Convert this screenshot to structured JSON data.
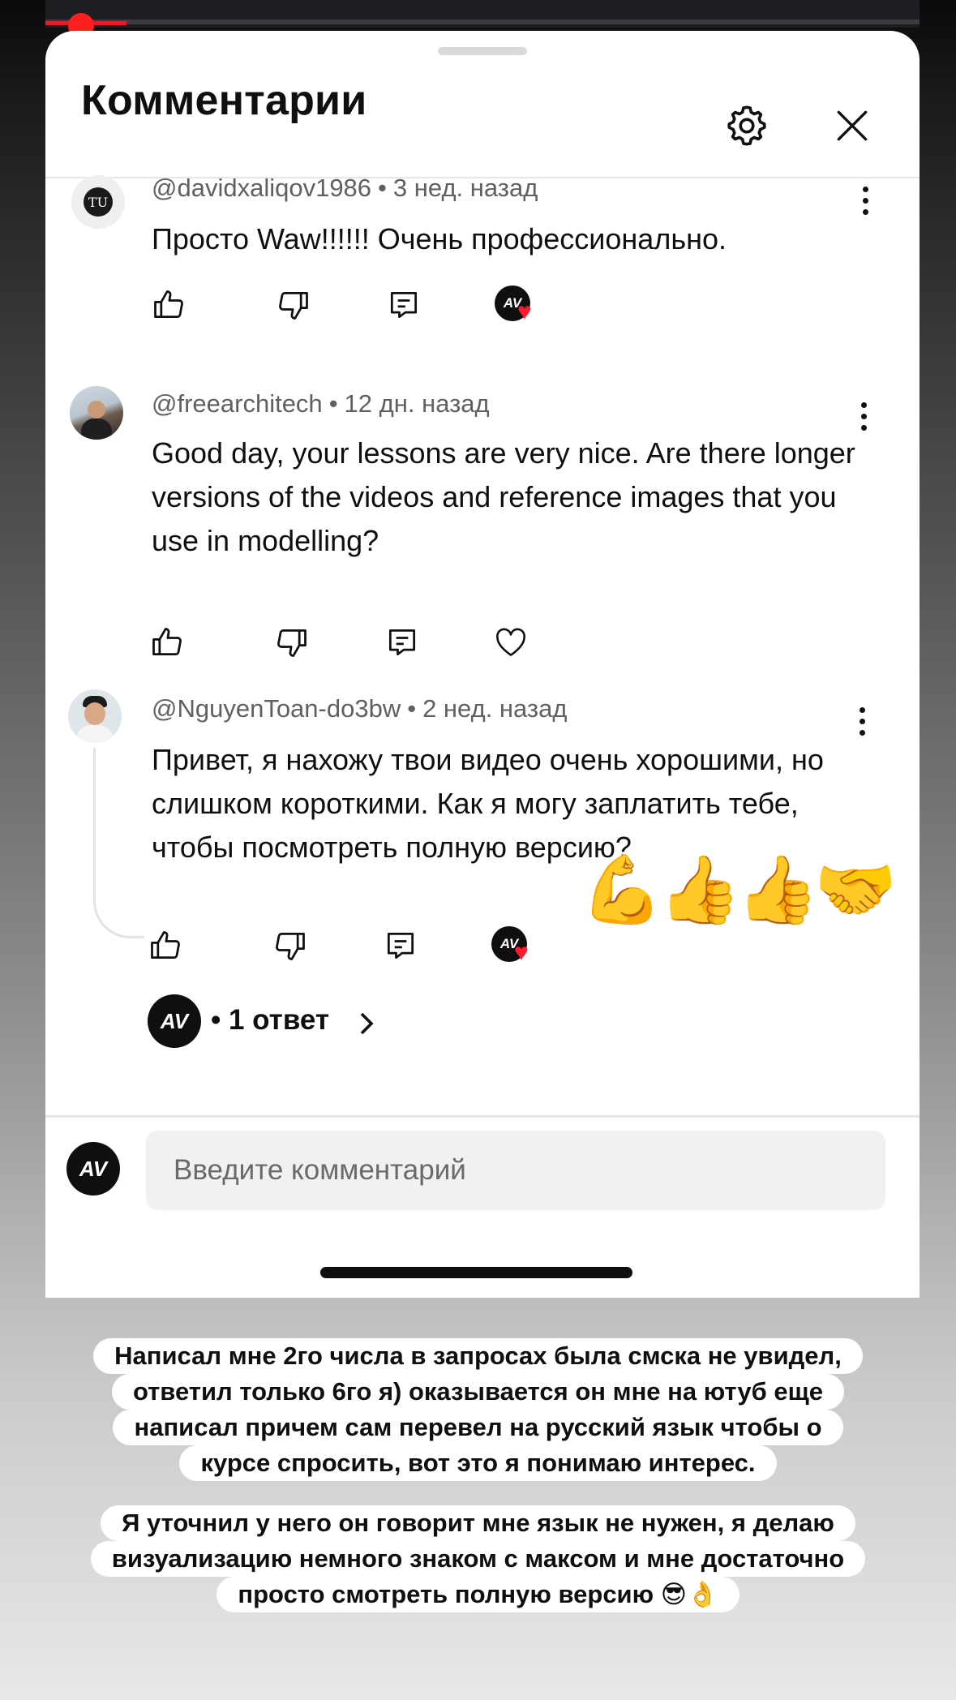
{
  "header": {
    "title": "Комментарии"
  },
  "comments": [
    {
      "author": "@davidxaliqov1986",
      "time": "3 нед. назад",
      "text": "Просто Waw!!!!!!  Очень профессионально.",
      "avatar_initials": "TU",
      "creator_heart": true
    },
    {
      "author": "@freearchitech",
      "time": "12 дн. назад",
      "text": "Good day, your lessons are very nice. Are there longer versions of the videos and reference images that you use in modelling?",
      "creator_heart": false
    },
    {
      "author": "@NguyenToan-do3bw",
      "time": "2 нед. назад",
      "text": "Привет, я нахожу твои видео очень хорошими, но слишком короткими. Как я могу заплатить тебе, чтобы посмотреть полную версию?",
      "creator_heart": true,
      "replies_label": "1 ответ"
    }
  ],
  "channel_badge": "AV",
  "sticker_emoji": "💪👍👍🤝",
  "input": {
    "placeholder": "Введите комментарий"
  },
  "captions": [
    [
      "Написал мне 2го числа в запросах была смска не увидел,",
      "ответил только 6го я) оказывается он мне на ютуб еще",
      "написал причем сам перевел на русский язык чтобы о",
      "курсе спросить, вот это я понимаю интерес."
    ],
    [
      "Я уточнил у него он говорит мне язык не нужен, я делаю",
      "визуализацию немного знаком с максом и мне достаточно",
      "просто смотреть полную версию 😎👌"
    ]
  ],
  "colors": {
    "sheet": "#ffffff",
    "meta_text": "#606060",
    "heart": "#ff1b2d",
    "recording_dot": "#ff1f1f"
  }
}
